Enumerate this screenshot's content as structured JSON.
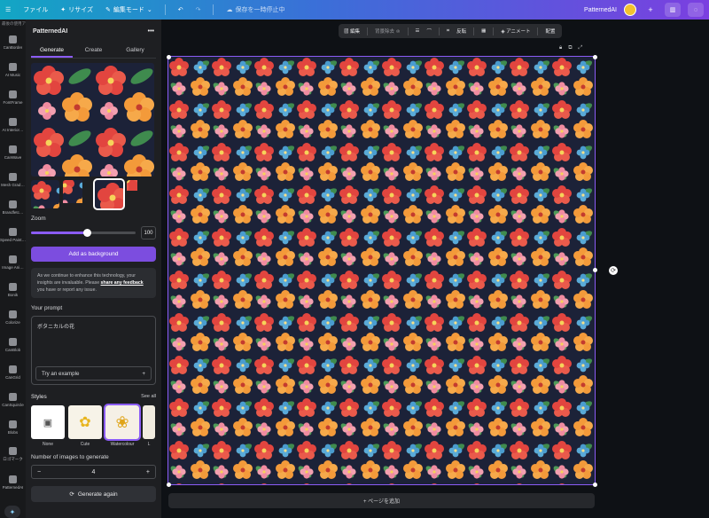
{
  "topbar": {
    "menu_icon": "hamburger-icon",
    "file": "ファイル",
    "resize": "リサイズ",
    "edit_mode": "編集モード",
    "save_status": "保存を一時停止中",
    "app_name": "PatternedAI"
  },
  "rail": {
    "header": "最後の使用アプリ",
    "items": [
      {
        "label": "CanBorder"
      },
      {
        "label": "AI Music"
      },
      {
        "label": "FontFrame"
      },
      {
        "label": "AI Interior…"
      },
      {
        "label": "CanWave"
      },
      {
        "label": "Mesh Grad…"
      },
      {
        "label": "Brandfetc…"
      },
      {
        "label": "Speed Paint…"
      },
      {
        "label": "Image Ani…"
      },
      {
        "label": "Bonik"
      },
      {
        "label": "Colorize"
      },
      {
        "label": "CanBlob"
      },
      {
        "label": "CanGrid"
      },
      {
        "label": "CanSquircle"
      },
      {
        "label": "Blobs"
      },
      {
        "label": "ロゴマーク"
      },
      {
        "label": "PatternedAI"
      }
    ]
  },
  "panel": {
    "title": "PatternedAI",
    "more": "•••",
    "tabs": [
      "Generate",
      "Create",
      "Gallery"
    ],
    "zoom_label": "Zoom",
    "zoom_value": "100",
    "zoom_fraction": 0.53,
    "add_bg": "Add as background",
    "notice_1": "As we continue to enhance this technology, your insights are invaluable. Please ",
    "notice_link1": "share any feedback",
    "notice_2": " you have or report any issue.",
    "prompt_label": "Your prompt",
    "prompt_value": "ボタニカルの花",
    "try_example": "Try an example",
    "plus": "+",
    "styles_label": "Styles",
    "see_all": "See all",
    "styles": [
      {
        "label": "None"
      },
      {
        "label": "Cute"
      },
      {
        "label": "Watercolour"
      },
      {
        "label": "L"
      }
    ],
    "num_label": "Number of images to generate",
    "num_value": "4",
    "minus": "−",
    "generate_again": "Generate again"
  },
  "context_toolbar": {
    "edit": "編集",
    "remove_bg": "背景除去",
    "flip": "反転",
    "animate": "アニメート",
    "position": "配置"
  },
  "canvas": {
    "add_page": "+ ページを追加"
  },
  "colors": {
    "accent": "#8b5cf6",
    "pattern_bg": "#1c2238"
  }
}
